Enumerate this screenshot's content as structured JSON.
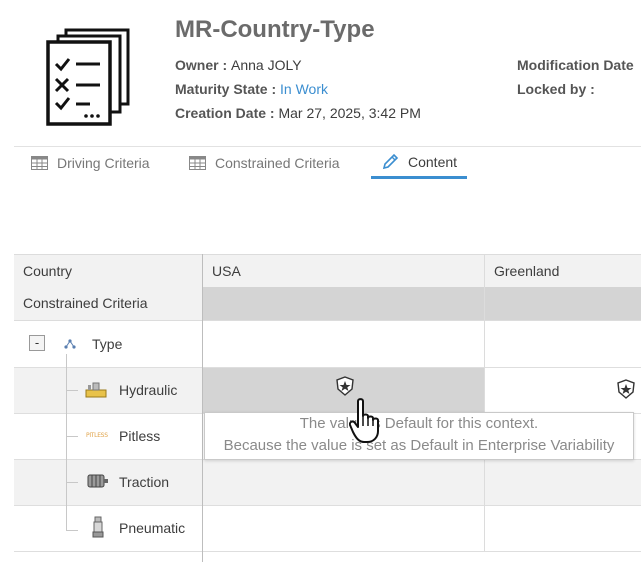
{
  "header": {
    "title": "MR-Country-Type",
    "owner_label": "Owner : ",
    "owner_value": "Anna JOLY",
    "maturity_label": "Maturity State : ",
    "maturity_value": "In Work",
    "creation_label": "Creation Date : ",
    "creation_value": "Mar 27, 2025, 3:42 PM",
    "modification_label": "Modification Date",
    "locked_label": "Locked by :"
  },
  "tabs": [
    {
      "label": "Driving Criteria",
      "icon": "table-icon",
      "active": false
    },
    {
      "label": "Constrained Criteria",
      "icon": "table-icon",
      "active": false
    },
    {
      "label": "Content",
      "icon": "pencil-icon",
      "active": true
    }
  ],
  "grid": {
    "header_row": [
      "Country",
      "USA",
      "Greenland"
    ],
    "subheader_label": "Constrained Criteria",
    "group": {
      "label": "Type",
      "toggle": "-"
    },
    "rows": [
      {
        "label": "Hydraulic",
        "usa": "default-badge-icon",
        "greenland": "default-badge-icon"
      },
      {
        "label": "Pitless",
        "icon_text": "PITLESS"
      },
      {
        "label": "Traction"
      },
      {
        "label": "Pneumatic"
      }
    ]
  },
  "tooltip": {
    "line1": "The value is Default for this context.",
    "line2": "Because the value is set as Default in Enterprise Variability"
  },
  "colors": {
    "accent": "#3b8ed0",
    "selected_cell": "#d4d4d4",
    "header_bg": "#f2f2f2"
  }
}
